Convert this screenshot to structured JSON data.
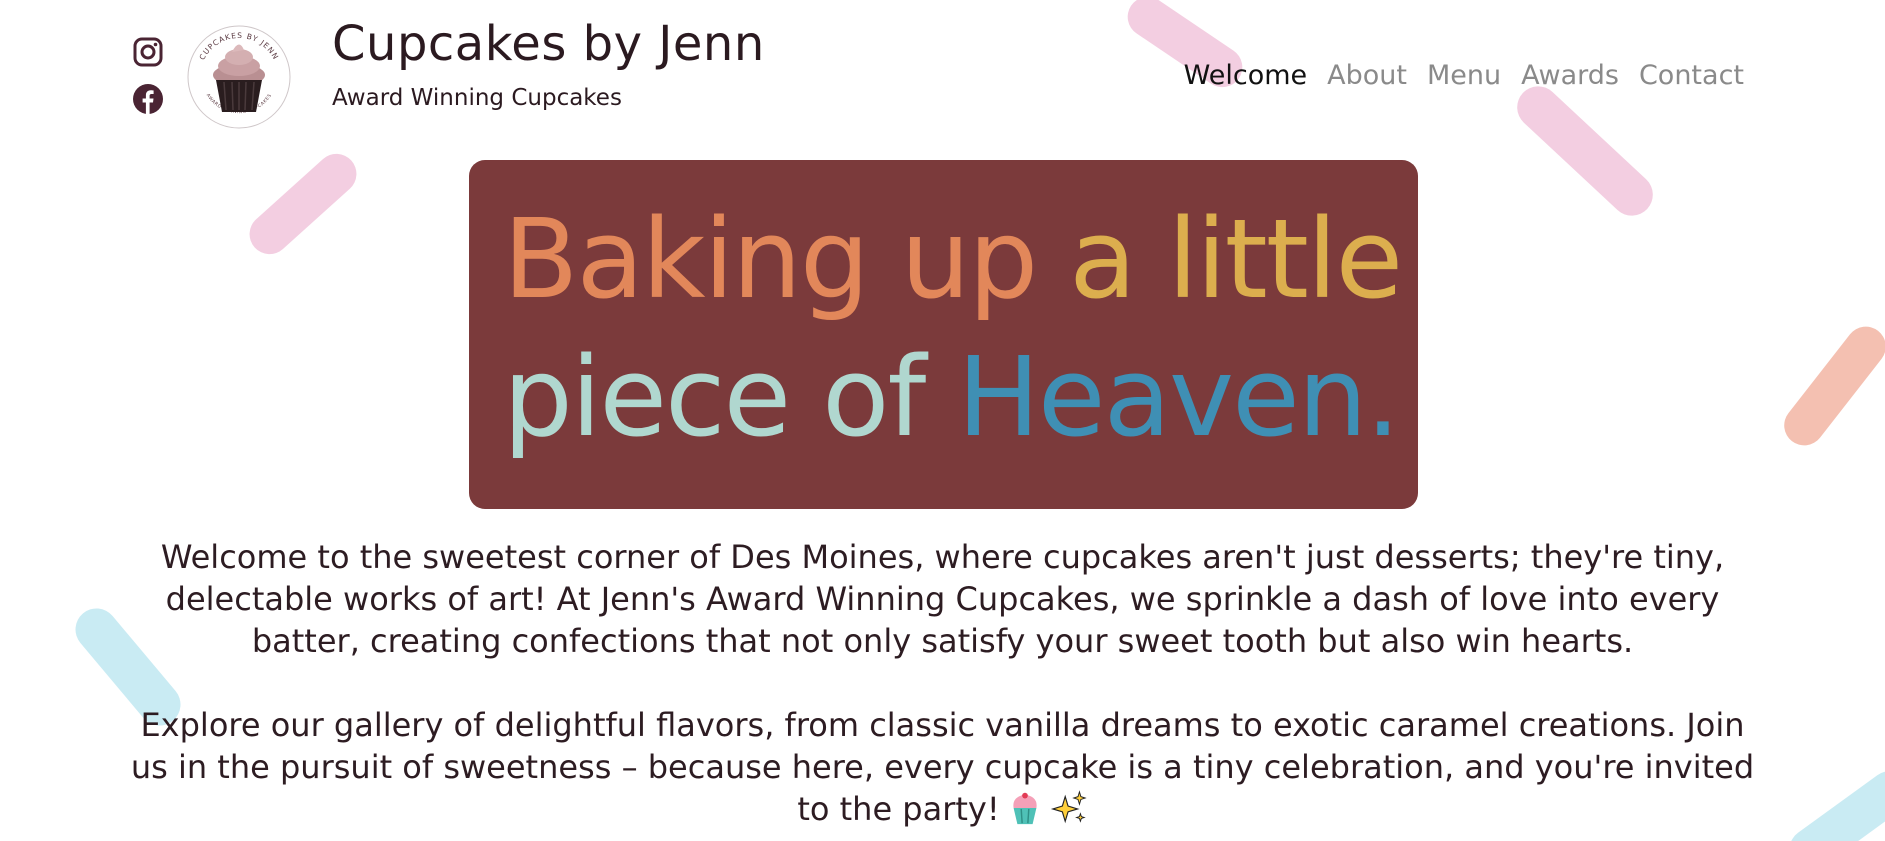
{
  "brand": {
    "title": "Cupcakes by Jenn",
    "subtitle": "Award Winning Cupcakes",
    "logo_text_top": "CUPCAKES BY JENN",
    "logo_text_bottom": "AWARD WINNING CUPCAKES"
  },
  "social": {
    "icons": [
      "instagram-icon",
      "facebook-icon"
    ],
    "color": "#4a2433"
  },
  "nav": {
    "items": [
      "Welcome",
      "About",
      "Menu",
      "Awards",
      "Contact"
    ],
    "active": "Welcome"
  },
  "hero": {
    "line1_part1": "Baking up",
    "line1_part2": "a little",
    "line2_part1": "piece of",
    "line2_part2": "Heaven.",
    "background": "#7b3a3b",
    "colors": {
      "orange": "#e2875a",
      "gold": "#dcae4e",
      "mint": "#b0d7cf",
      "blue": "#3f8fb4"
    }
  },
  "intro": {
    "paragraph1": "Welcome to the sweetest corner of Des Moines, where cupcakes aren't just desserts; they're tiny, delectable works of art! At Jenn's Award Winning Cupcakes, we sprinkle a dash of love into every batter, creating confections that not only satisfy your sweet tooth but also win hearts.",
    "paragraph2": "Explore our gallery of delightful flavors, from classic vanilla dreams to exotic caramel creations. Join us in the pursuit of sweetness – because here, every cupcake is a tiny celebration, and you're invited to the party!",
    "emojis": [
      "cupcake-icon",
      "sparkles-icon"
    ]
  }
}
